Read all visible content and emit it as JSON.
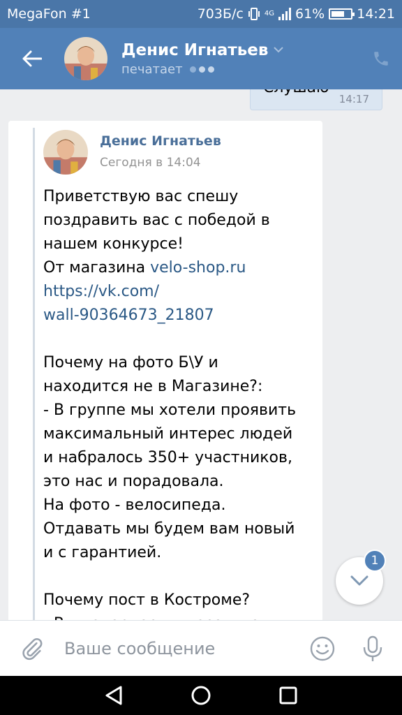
{
  "status_bar": {
    "carrier": "MegaFon #1",
    "speed": "703Б/с",
    "network": "4G",
    "battery": "61%",
    "battery_level": 0.61,
    "time": "14:21"
  },
  "header": {
    "name": "Денис Игнатьев",
    "status": "печатает"
  },
  "outgoing_message": {
    "text": "Слушаю",
    "time": "14:17"
  },
  "forwarded": {
    "author": "Денис Игнатьев",
    "date": "Сегодня в 14:04",
    "lines": {
      "l1": "Приветствую вас спешу",
      "l2": "поздравить вас с победой в",
      "l3": "нашем конкурсе!",
      "l4_prefix": "От магазина ",
      "l4_link": "velo-shop.ru",
      "l5": "https://vk.com/",
      "l6": "wall-90364673_21807",
      "l7": "Почему на фото Б\\У и",
      "l8": "находится не в Магазине?:",
      "l9": "- В группе мы хотели проявить",
      "l10": "максимальный интерес людей",
      "l11": "и набралось 350+ участников,",
      "l12": "это нас и порадовала.",
      "l13": "На фото - велосипеда.",
      "l14": "Отдавать мы будем вам новый",
      "l15": "и с гарантией.",
      "l16": "Почему пост в Костроме?",
      "l17": "- Вы наверное в курсе, что"
    }
  },
  "unread_count": "1",
  "composer": {
    "placeholder": "Ваше сообщение"
  },
  "colors": {
    "header": "#5181b8",
    "status_bar": "#4a76a8",
    "link": "#2a5885",
    "outgoing_bubble": "#dbe6f2"
  }
}
